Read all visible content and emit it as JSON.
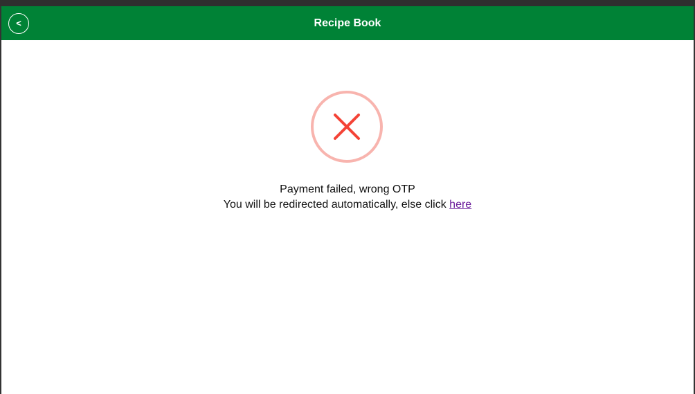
{
  "header": {
    "title": "Recipe Book",
    "back_label": "<",
    "background": "#008236"
  },
  "status": {
    "icon": "error-x-icon",
    "ring_color": "#f8b4ae",
    "cross_color": "#f44336"
  },
  "message": {
    "line1": "Payment failed, wrong OTP",
    "line2_prefix": "You will be redirected automatically, else click",
    "link_text": "here",
    "link_color": "#6a1b9a"
  }
}
